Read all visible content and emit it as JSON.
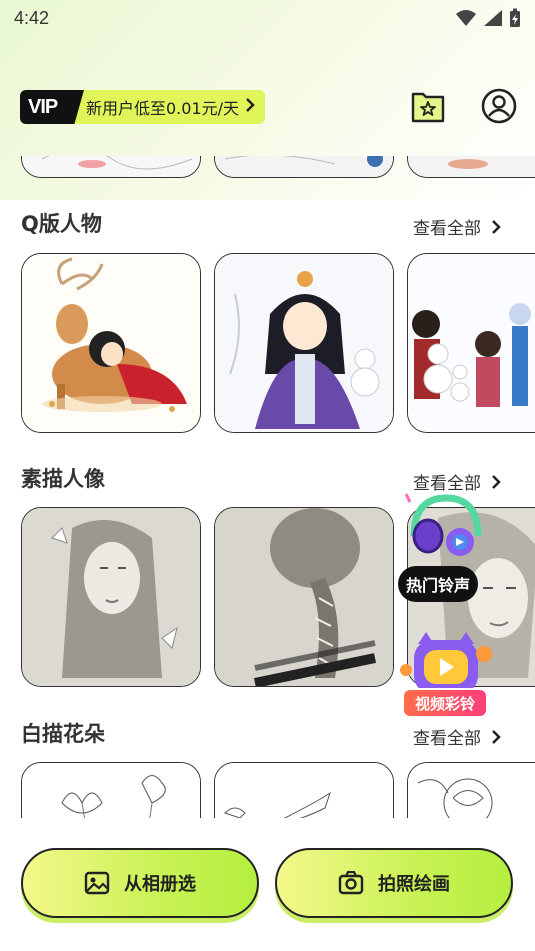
{
  "status_bar": {
    "time": "4:42"
  },
  "header": {
    "vip_badge": "VIP",
    "vip_text": "新用户低至0.01元/天",
    "vip_arrow": ">"
  },
  "sections": [
    {
      "title": "Q版人物",
      "view_all": "查看全部"
    },
    {
      "title": "素描人像",
      "view_all": "查看全部"
    },
    {
      "title": "白描花朵",
      "view_all": "查看全部"
    }
  ],
  "floating": {
    "ringtone_label": "热门铃声",
    "video_ringtone_label": "视频彩铃"
  },
  "bottom_actions": {
    "album_label": "从相册选",
    "camera_label": "拍照绘画"
  },
  "colors": {
    "accent_green": "#c8f254",
    "vip_yellow": "#dff55a",
    "dark": "#111111"
  }
}
